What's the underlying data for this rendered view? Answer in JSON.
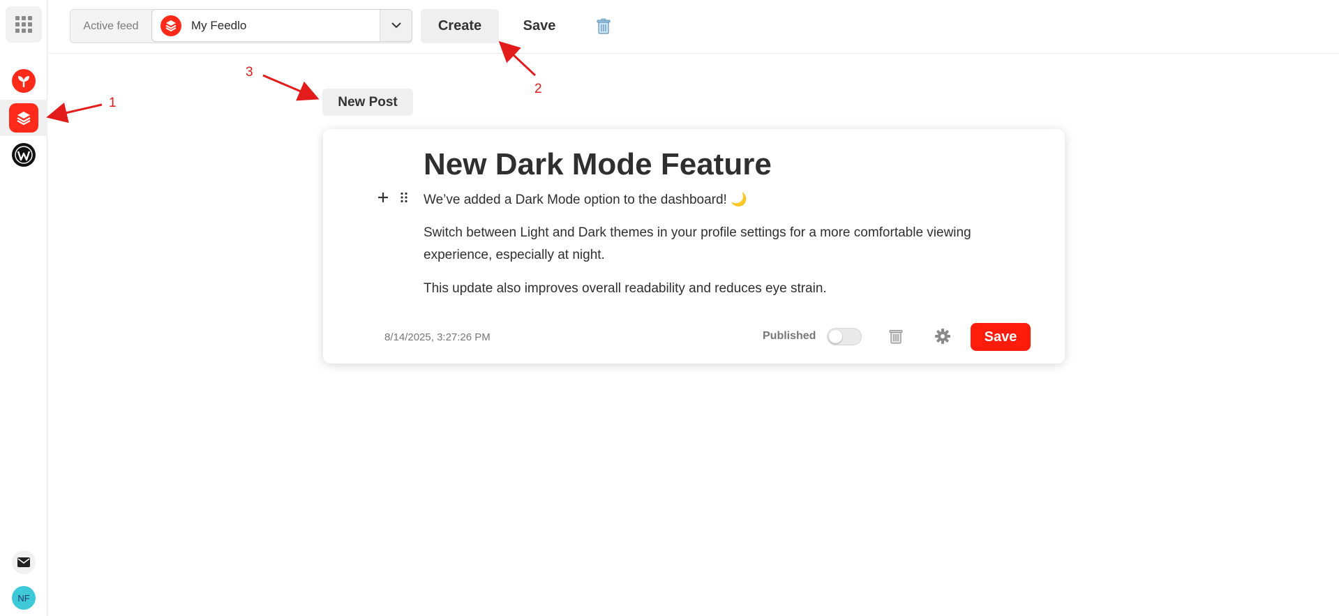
{
  "sidebar": {
    "avatar_initials": "NF",
    "apps": [
      {
        "name": "sprout-app",
        "color": "#ff2a1a"
      },
      {
        "name": "feedlo-app",
        "color": "#ff2a1a",
        "active": true
      },
      {
        "name": "wordpress-app",
        "color": "#111111"
      }
    ]
  },
  "topbar": {
    "active_feed_label": "Active feed",
    "feed_name": "My Feedlo",
    "create_label": "Create",
    "save_label": "Save"
  },
  "annotations": {
    "one": "1",
    "two": "2",
    "three": "3",
    "color": "#e21b1b"
  },
  "post": {
    "chip_label": "New Post",
    "title": "New Dark Mode Feature",
    "paragraphs": [
      "We’ve added a Dark Mode option to the dashboard! 🌙",
      "Switch between Light and Dark themes in your profile settings for a more comfortable viewing experience, especially at night.",
      "This update also improves overall readability and reduces eye strain."
    ],
    "timestamp": "8/14/2025, 3:27:26 PM",
    "published_label": "Published",
    "published": false,
    "save_label": "Save"
  },
  "colors": {
    "brand_red": "#ff1c0b",
    "avatar_bg": "#3ec9d9"
  }
}
